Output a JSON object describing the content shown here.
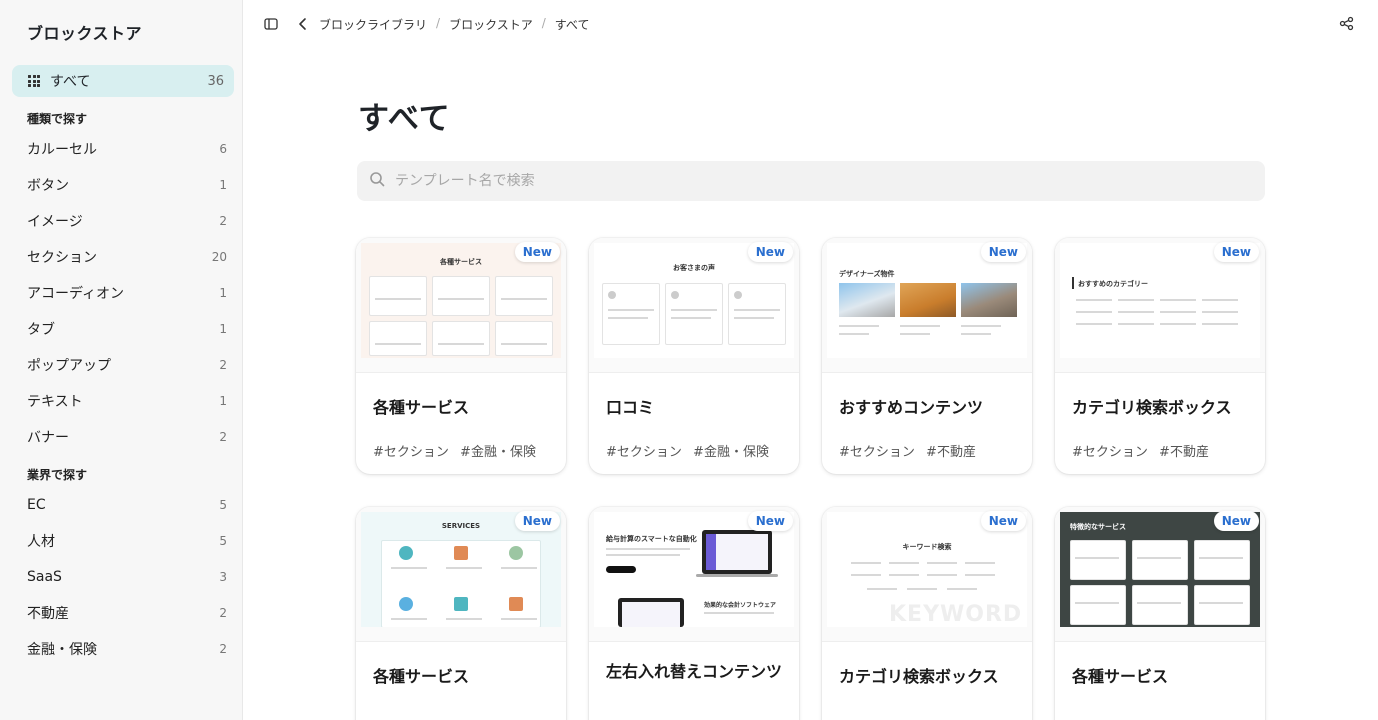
{
  "sidebar": {
    "brand": "ブロックストア",
    "all": {
      "label": "すべて",
      "count": "36"
    },
    "section_type": "種類で探す",
    "types": [
      {
        "label": "カルーセル",
        "count": "6"
      },
      {
        "label": "ボタン",
        "count": "1"
      },
      {
        "label": "イメージ",
        "count": "2"
      },
      {
        "label": "セクション",
        "count": "20"
      },
      {
        "label": "アコーディオン",
        "count": "1"
      },
      {
        "label": "タブ",
        "count": "1"
      },
      {
        "label": "ポップアップ",
        "count": "2"
      },
      {
        "label": "テキスト",
        "count": "1"
      },
      {
        "label": "バナー",
        "count": "2"
      }
    ],
    "section_industry": "業界で探す",
    "industries": [
      {
        "label": "EC",
        "count": "5"
      },
      {
        "label": "人材",
        "count": "5"
      },
      {
        "label": "SaaS",
        "count": "3"
      },
      {
        "label": "不動産",
        "count": "2"
      },
      {
        "label": "金融・保険",
        "count": "2"
      }
    ]
  },
  "topbar": {
    "breadcrumb": [
      "ブロックライブラリ",
      "ブロックストア",
      "すべて"
    ]
  },
  "main": {
    "title": "すべて",
    "search_placeholder": "テンプレート名で検索",
    "new_label": "New",
    "cards": [
      {
        "title": "各種サービス",
        "tags": [
          "#セクション",
          "#金融・保険"
        ],
        "thumb": {
          "heading": "各種サービス"
        }
      },
      {
        "title": "口コミ",
        "tags": [
          "#セクション",
          "#金融・保険"
        ],
        "thumb": {
          "heading": "お客さまの声"
        }
      },
      {
        "title": "おすすめコンテンツ",
        "tags": [
          "#セクション",
          "#不動産"
        ],
        "thumb": {
          "heading": "デザイナーズ物件"
        }
      },
      {
        "title": "カテゴリ検索ボックス",
        "tags": [
          "#セクション",
          "#不動産"
        ],
        "thumb": {
          "heading": "おすすめのカテゴリー"
        }
      },
      {
        "title": "各種サービス",
        "tags": [],
        "thumb": {
          "heading": "SERVICES"
        }
      },
      {
        "title": "左右入れ替えコンテンツ",
        "tags": [],
        "thumb": {
          "heading": "給与計算のスマートな自動化",
          "heading2": "効果的な会計ソフトウェア"
        }
      },
      {
        "title": "カテゴリ検索ボックス",
        "tags": [],
        "thumb": {
          "heading": "キーワード検索",
          "watermark": "KEYWORD"
        }
      },
      {
        "title": "各種サービス",
        "tags": [],
        "thumb": {
          "heading": "特徴的なサービス"
        }
      }
    ]
  },
  "colors": {
    "accent_bg": "#d8eff0",
    "new_badge": "#2b6fcf",
    "sidebar_bg": "#f7f7f7"
  }
}
